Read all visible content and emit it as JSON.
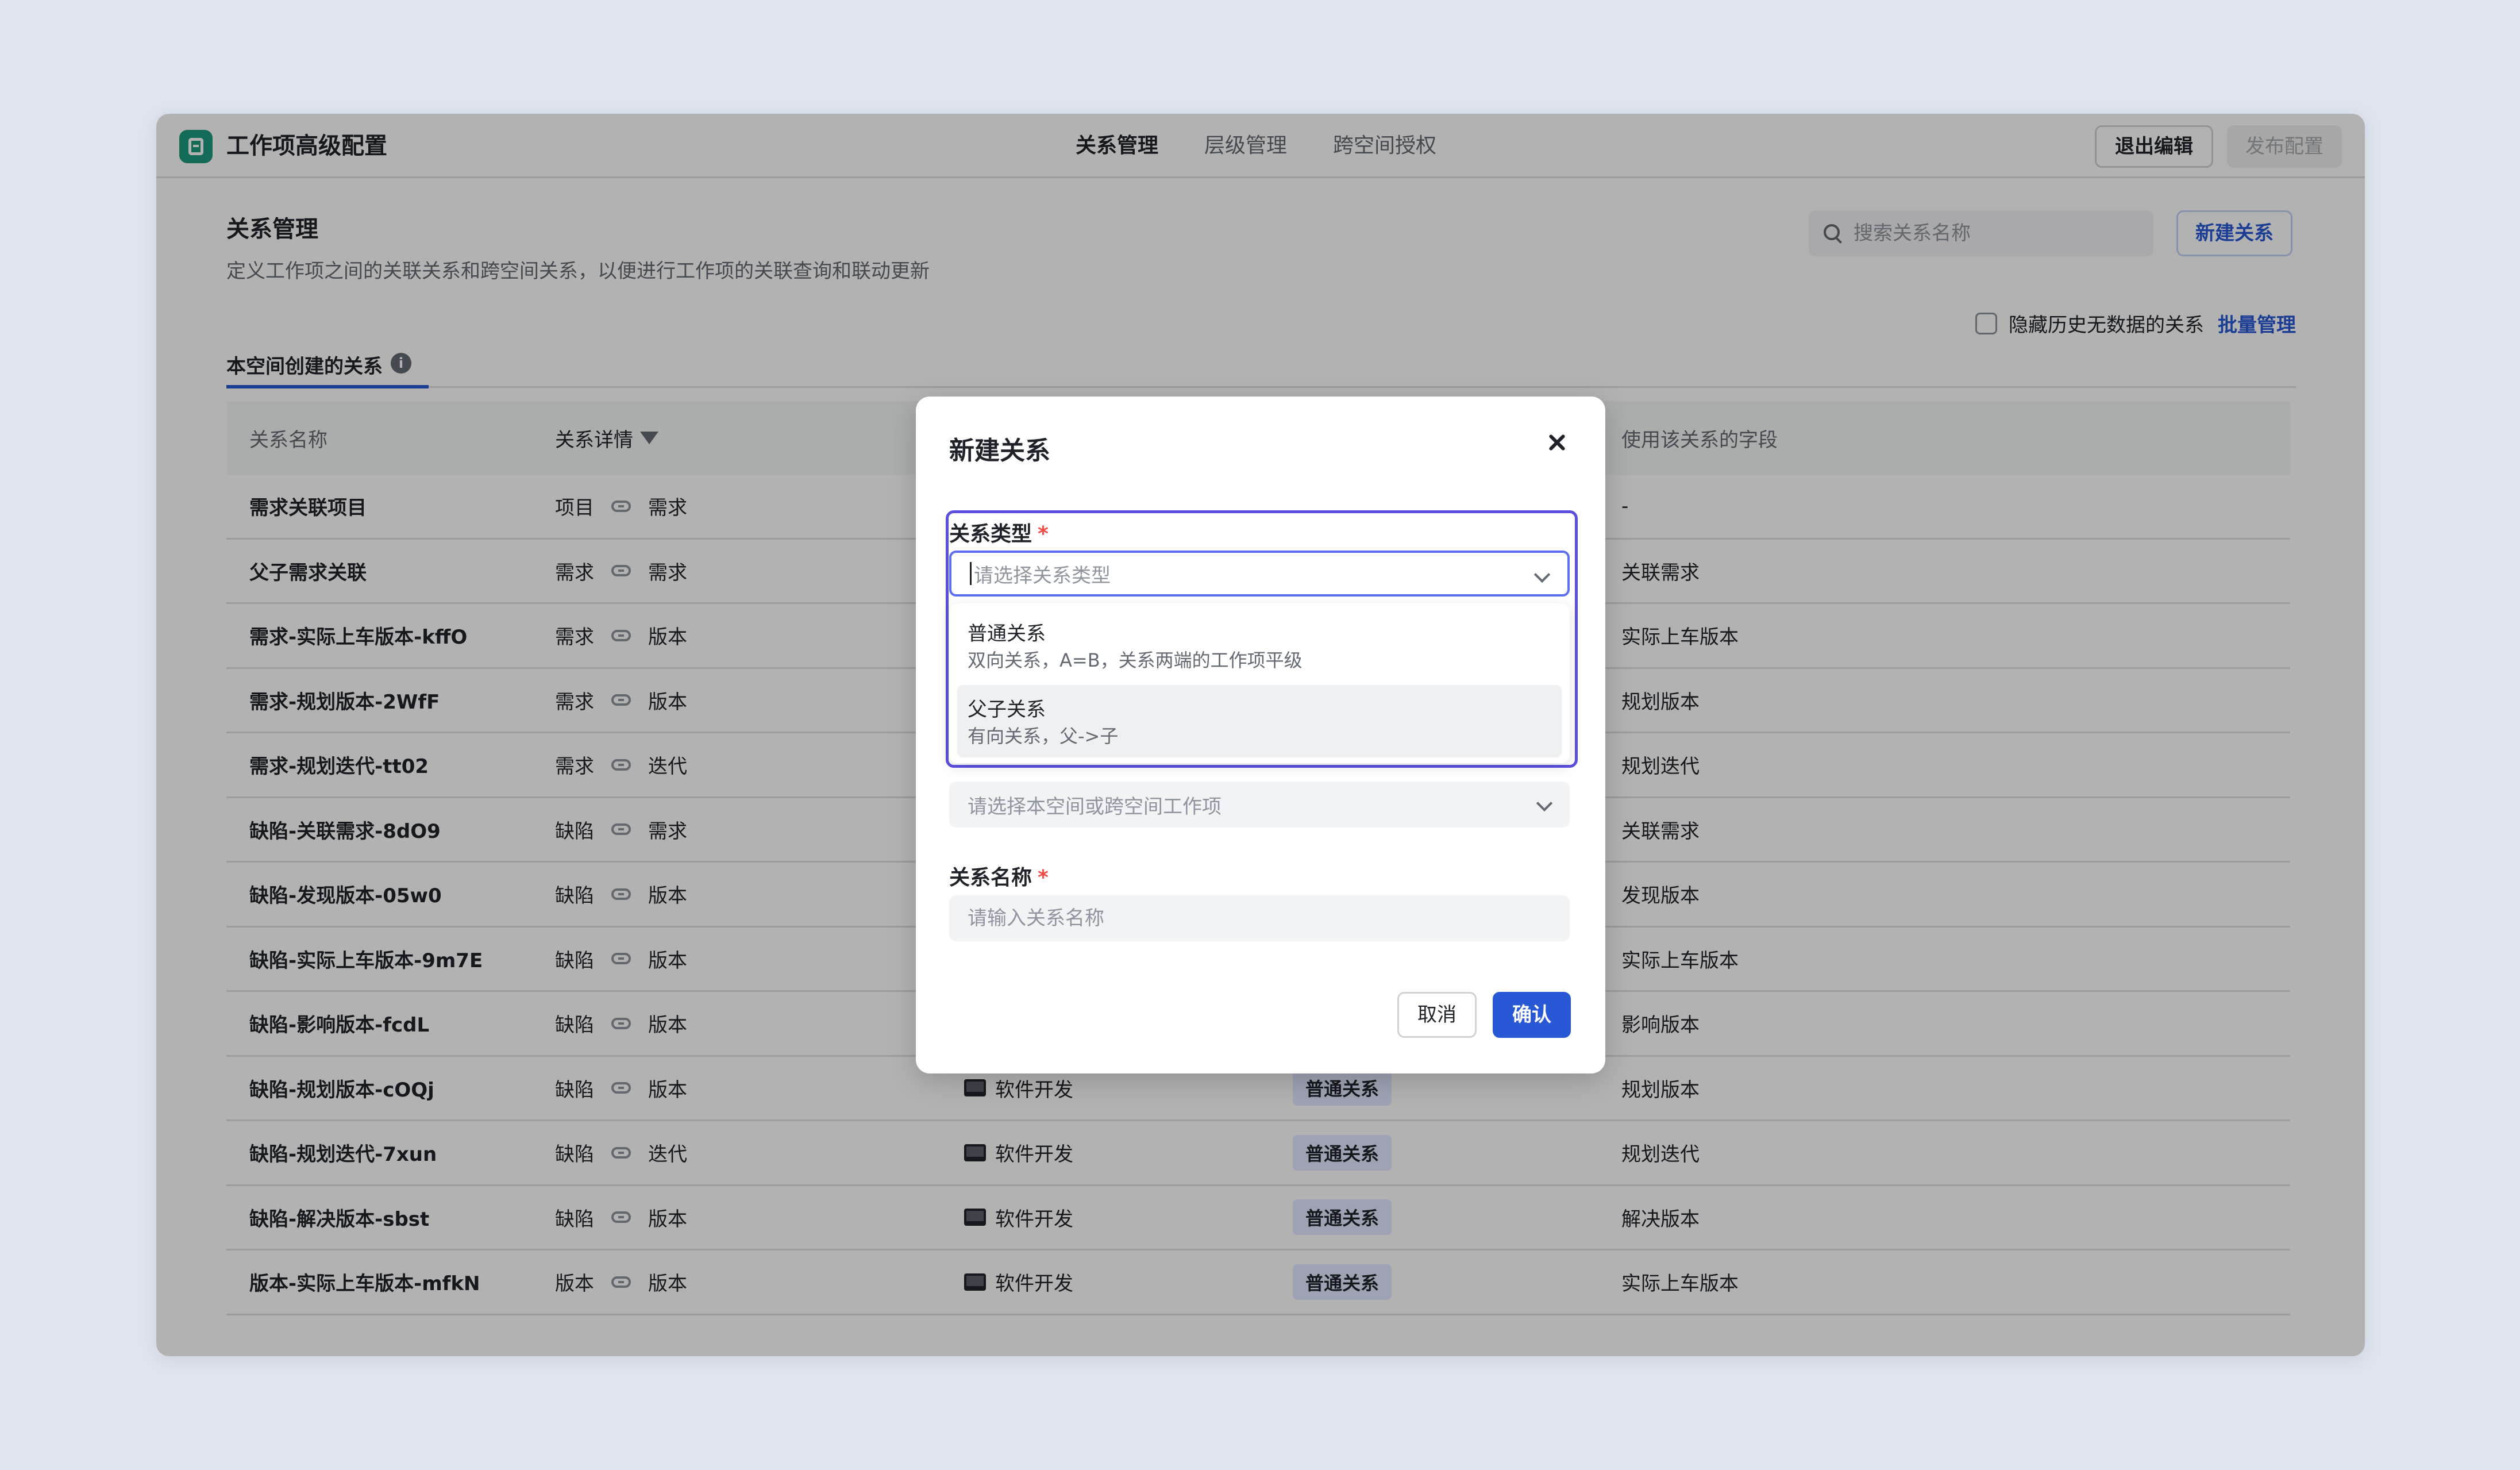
{
  "app": {
    "title": "工作项高级配置",
    "logo_icon": "sheet-icon",
    "brand_color": "#1d9a7e"
  },
  "nav": {
    "tabs": [
      {
        "label": "关系管理",
        "active": true
      },
      {
        "label": "层级管理"
      },
      {
        "label": "跨空间授权"
      }
    ]
  },
  "actions": {
    "exit_edit": "退出编辑",
    "publish": "发布配置"
  },
  "page": {
    "title": "关系管理",
    "desc": "定义工作项之间的关联关系和跨空间关系，以便进行工作项的关联查询和联动更新",
    "search_placeholder": "搜索关系名称",
    "new_button": "新建关系",
    "hide_label": "隐藏历史无数据的关系",
    "batch_manage": "批量管理",
    "subtab": "本空间创建的关系"
  },
  "table": {
    "headers": {
      "name": "关系名称",
      "detail": "关系详情",
      "space": "",
      "type": "",
      "fields": "使用该关系的字段"
    },
    "rows": [
      {
        "name": "需求关联项目",
        "from": "项目",
        "to": "需求",
        "space": "",
        "type": "",
        "field": "-"
      },
      {
        "name": "父子需求关联",
        "from": "需求",
        "to": "需求",
        "space": "",
        "type": "",
        "field": "关联需求"
      },
      {
        "name": "需求-实际上车版本-kffO",
        "from": "需求",
        "to": "版本",
        "space": "",
        "type": "",
        "field": "实际上车版本"
      },
      {
        "name": "需求-规划版本-2WfF",
        "from": "需求",
        "to": "版本",
        "space": "",
        "type": "",
        "field": "规划版本"
      },
      {
        "name": "需求-规划迭代-tt02",
        "from": "需求",
        "to": "迭代",
        "space": "",
        "type": "",
        "field": "规划迭代"
      },
      {
        "name": "缺陷-关联需求-8dO9",
        "from": "缺陷",
        "to": "需求",
        "space": "",
        "type": "",
        "field": "关联需求"
      },
      {
        "name": "缺陷-发现版本-05w0",
        "from": "缺陷",
        "to": "版本",
        "space": "",
        "type": "",
        "field": "发现版本"
      },
      {
        "name": "缺陷-实际上车版本-9m7E",
        "from": "缺陷",
        "to": "版本",
        "space": "",
        "type": "",
        "field": "实际上车版本"
      },
      {
        "name": "缺陷-影响版本-fcdL",
        "from": "缺陷",
        "to": "版本",
        "space": "",
        "type": "",
        "field": "影响版本"
      },
      {
        "name": "缺陷-规划版本-cOQj",
        "from": "缺陷",
        "to": "版本",
        "space": "软件开发",
        "type": "普通关系",
        "field": "规划版本"
      },
      {
        "name": "缺陷-规划迭代-7xun",
        "from": "缺陷",
        "to": "迭代",
        "space": "软件开发",
        "type": "普通关系",
        "field": "规划迭代"
      },
      {
        "name": "缺陷-解决版本-sbst",
        "from": "缺陷",
        "to": "版本",
        "space": "软件开发",
        "type": "普通关系",
        "field": "解决版本"
      },
      {
        "name": "版本-实际上车版本-mfkN",
        "from": "版本",
        "to": "版本",
        "space": "软件开发",
        "type": "普通关系",
        "field": "实际上车版本"
      }
    ]
  },
  "modal": {
    "title": "新建关系",
    "type_label": "关系类型",
    "type_placeholder": "请选择关系类型",
    "options": [
      {
        "title": "普通关系",
        "desc": "双向关系，A=B，关系两端的工作项平级"
      },
      {
        "title": "父子关系",
        "desc": "有向关系，父->子"
      }
    ],
    "workitem_placeholder": "请选择本空间或跨空间工作项",
    "name_label": "关系名称",
    "name_placeholder": "请输入关系名称",
    "cancel": "取消",
    "confirm": "确认",
    "required_mark": "*"
  },
  "colors": {
    "primary": "#2858d5",
    "focus": "#5b4fe0",
    "required": "#f54a45"
  }
}
